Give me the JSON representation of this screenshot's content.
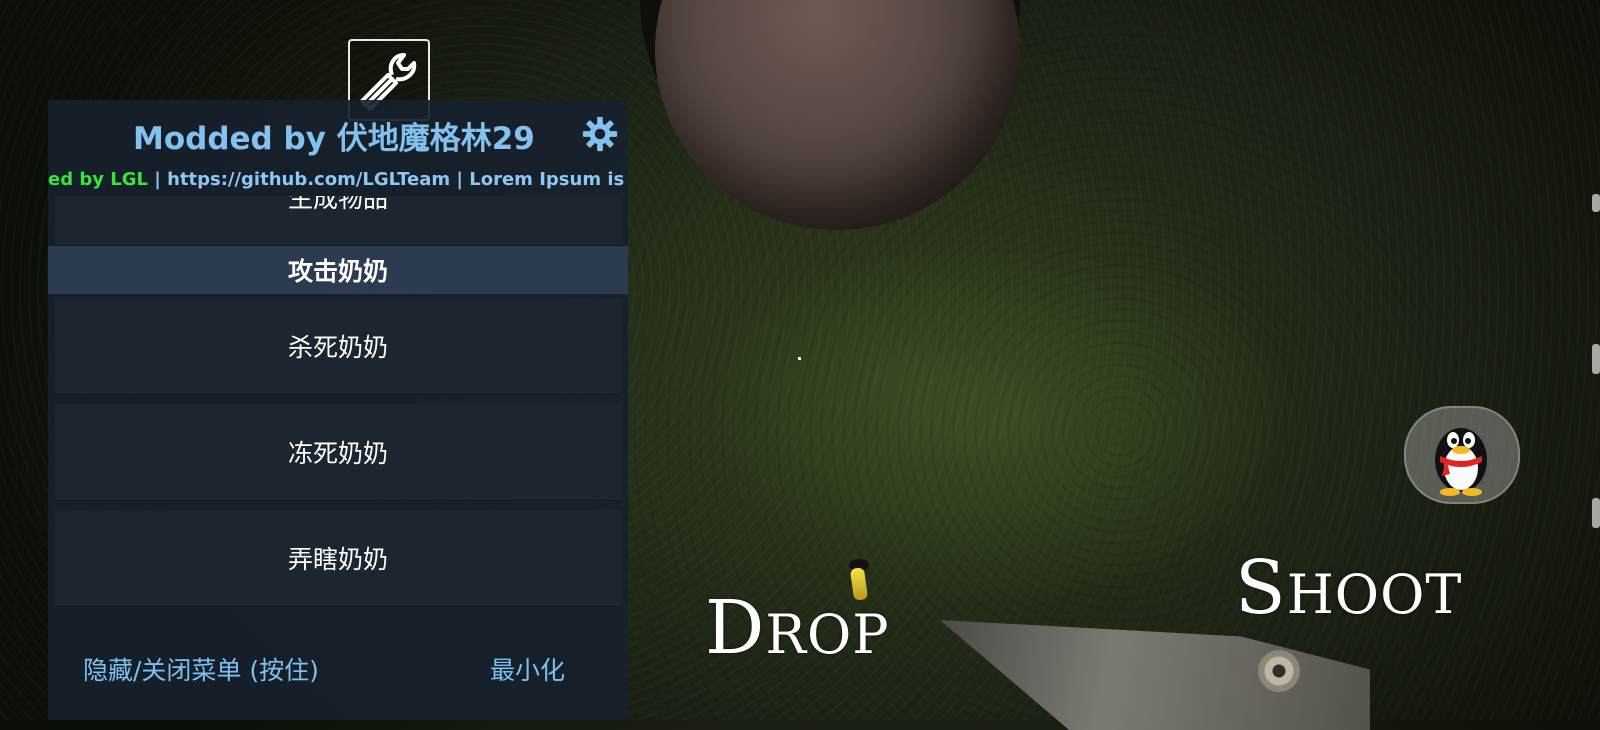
{
  "game": {
    "drop_button": {
      "first": "D",
      "rest": "ROP"
    },
    "shoot_button": {
      "first": "S",
      "rest": "HOOT"
    },
    "icons": [
      "wrench-icon",
      "penguin-icon",
      "crosshair-dot"
    ]
  },
  "menu": {
    "title": "Modded by 伏地魔格林29",
    "marquee": {
      "green_text": "ed by LGL",
      "blue_text": " | https://github.com/LGLTeam | Lorem Ipsum is simply d"
    },
    "items_top": [
      {
        "label": "生成物品"
      }
    ],
    "section_header": "攻击奶奶",
    "items": [
      {
        "label": "杀死奶奶"
      },
      {
        "label": "冻死奶奶"
      },
      {
        "label": "弄瞎奶奶"
      }
    ],
    "footer": {
      "hide_close": "隐藏/关闭菜单 (按住)",
      "minimize": "最小化"
    },
    "colors": {
      "title": "#83c1ef",
      "green_text": "#38e33a",
      "panel": "#17212c",
      "section": "#2d3b50"
    }
  }
}
